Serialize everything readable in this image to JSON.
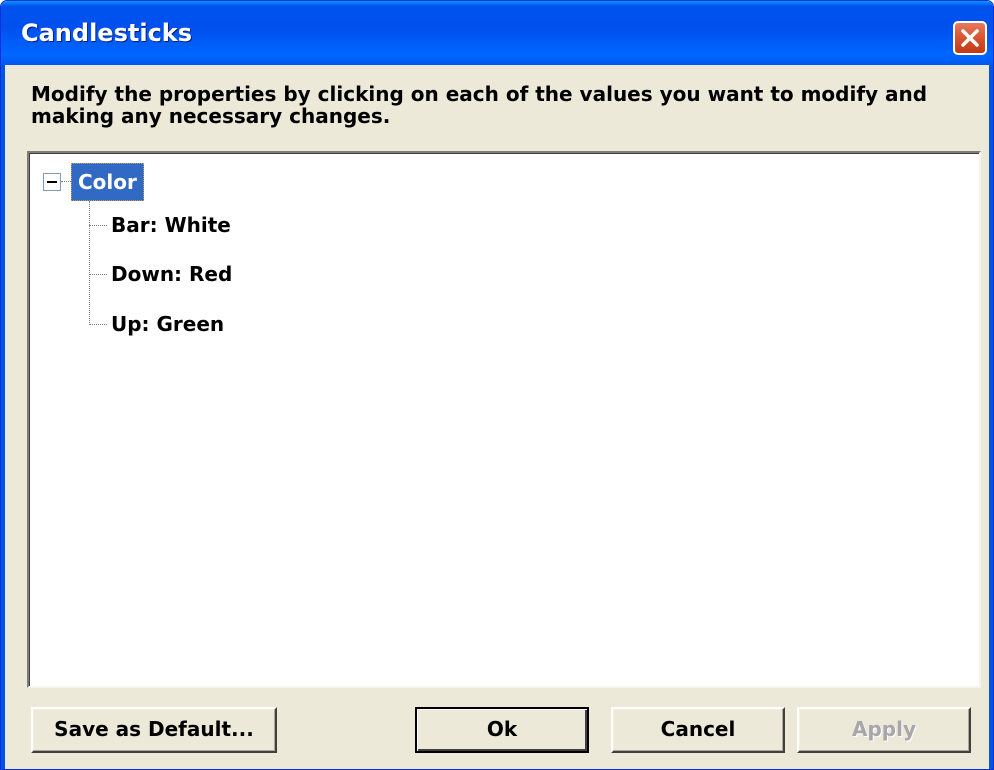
{
  "window": {
    "title": "Candlesticks",
    "titlebar_color": "#0054e3",
    "close_icon": "close-icon"
  },
  "instruction": "Modify the properties by clicking on each of the values you want to modify and making any necessary changes.",
  "tree": {
    "root": {
      "label": "Color",
      "expanded": true,
      "selected": true,
      "selection_color": "#316ac5"
    },
    "children": [
      {
        "label": "Bar: White"
      },
      {
        "label": "Down: Red"
      },
      {
        "label": "Up: Green"
      }
    ]
  },
  "buttons": {
    "save_default": "Save as Default...",
    "ok": "Ok",
    "cancel": "Cancel",
    "apply": "Apply",
    "apply_enabled": false
  }
}
